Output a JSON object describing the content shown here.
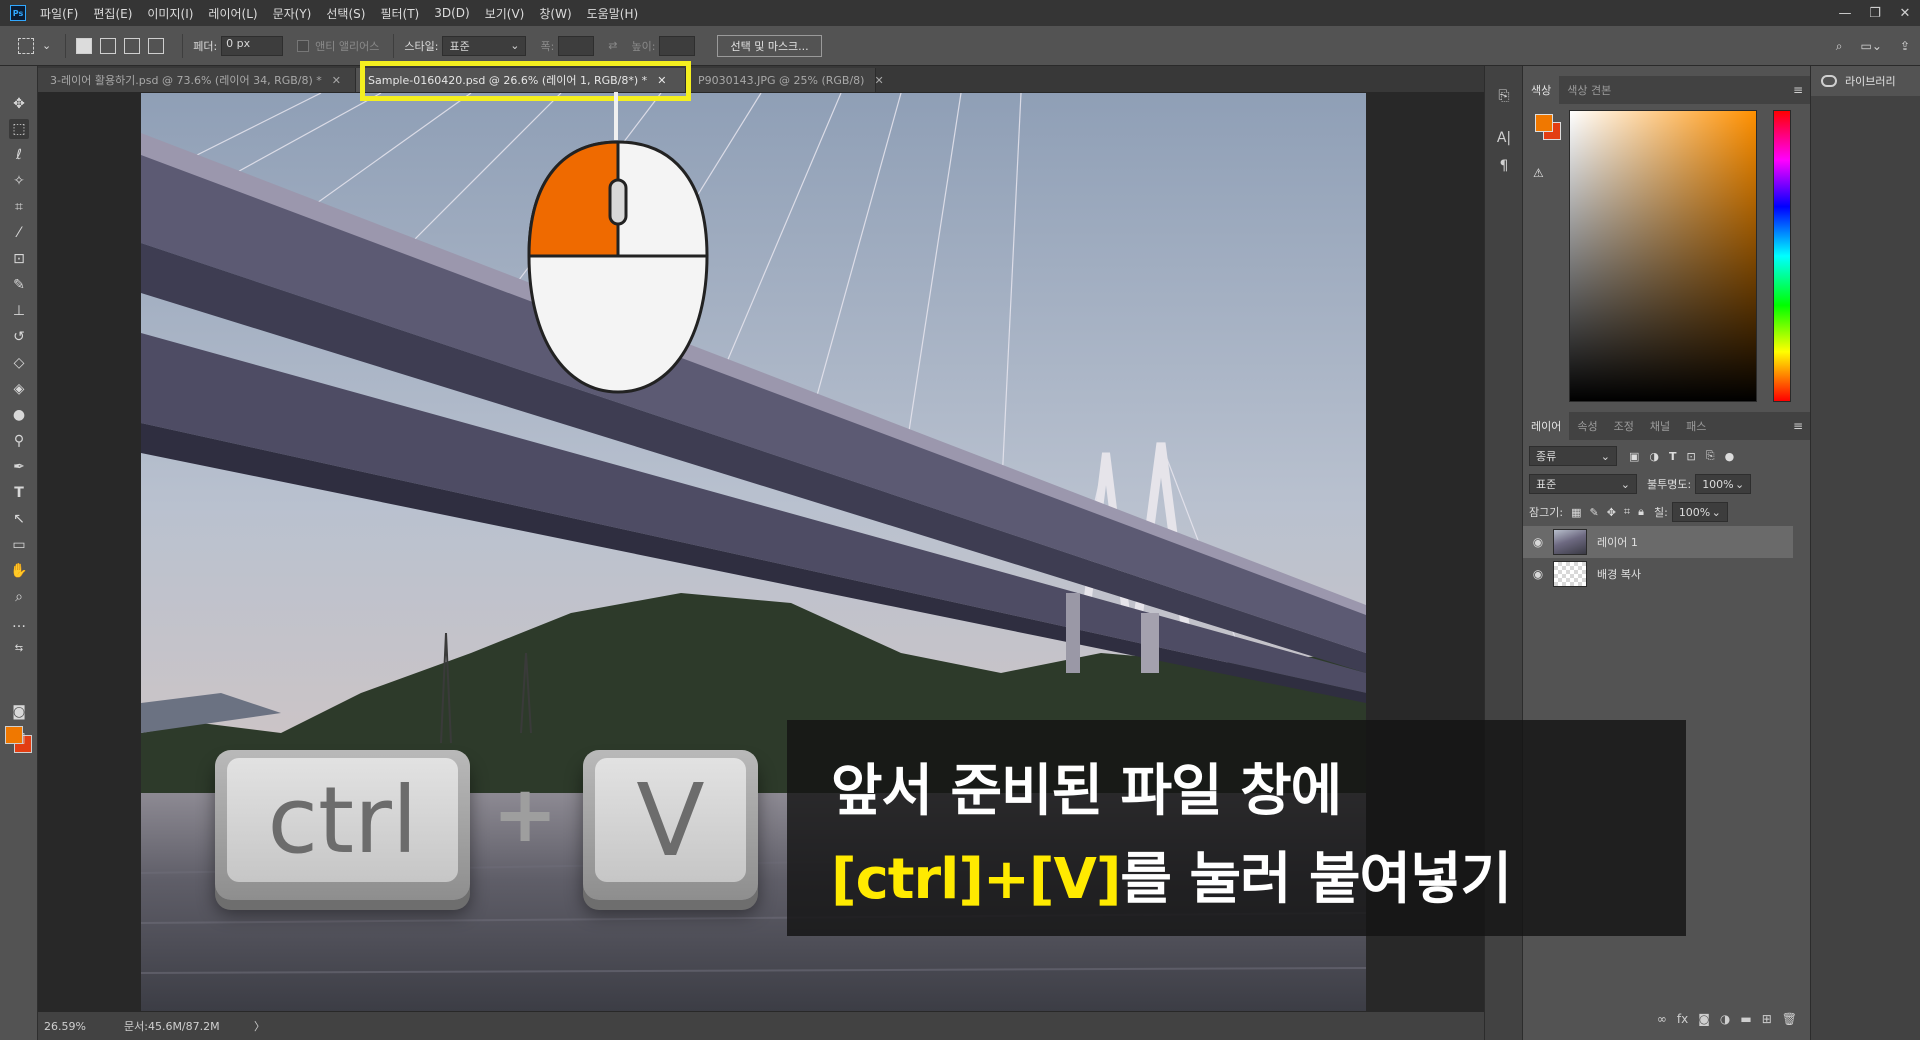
{
  "app": {
    "logo_text": "Ps"
  },
  "menu": [
    "파일(F)",
    "편집(E)",
    "이미지(I)",
    "레이어(L)",
    "문자(Y)",
    "선택(S)",
    "필터(T)",
    "3D(D)",
    "보기(V)",
    "창(W)",
    "도움말(H)"
  ],
  "window_controls": {
    "minimize": "—",
    "restore": "❐",
    "close": "✕"
  },
  "options": {
    "feather_label": "페더:",
    "feather_value": "0 px",
    "antialias_label": "앤티 앨리어스",
    "style_label": "스타일:",
    "style_value": "표준",
    "width_label": "폭:",
    "height_label": "높이:",
    "select_mask_button": "선택 및 마스크..."
  },
  "tabs": [
    {
      "label": "3-레이어 활용하기.psd @ 73.6% (레이어 34, RGB/8) *",
      "close": "✕"
    },
    {
      "label": "Sample-0160420.psd @ 26.6% (레이어 1, RGB/8*) *",
      "close": "✕"
    },
    {
      "label": "P9030143.JPG @ 25% (RGB/8)",
      "close": "✕"
    }
  ],
  "status": {
    "zoom": "26.59%",
    "doc": "문서:45.6M/87.2M",
    "arrow": "〉"
  },
  "color_panel": {
    "tabs": [
      "색상",
      "색상 견본"
    ]
  },
  "layers_panel": {
    "tabs": [
      "레이어",
      "속성",
      "조정",
      "채널",
      "패스"
    ],
    "filter_kind": "종류",
    "blend_mode": "표준",
    "opacity_label": "불투명도:",
    "opacity_value": "100%",
    "lock_label": "잠그기:",
    "fill_label": "칠:",
    "fill_value": "100%",
    "layers": [
      {
        "name": "레이어 1",
        "selected": true
      },
      {
        "name": "배경 복사",
        "selected": false
      }
    ]
  },
  "library": {
    "label": "라이브러리"
  },
  "overlay": {
    "key_ctrl": "ctrl",
    "plus": "+",
    "key_v": "V",
    "caption_line1": "앞서 준비된 파일 창에",
    "caption_line2_a": "[ctrl]+[V]",
    "caption_line2_b": "를 눌러 붙여넣기"
  },
  "colors": {
    "foreground": "#f07800",
    "background": "#e33e12",
    "highlight": "#f4ef1f",
    "accent_orange": "#ef6a00"
  }
}
